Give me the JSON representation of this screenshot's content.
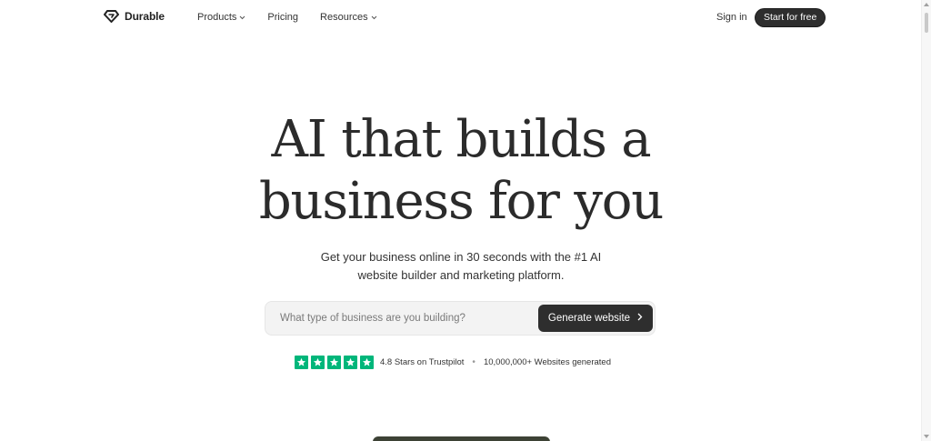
{
  "nav": {
    "brand": "Durable",
    "links": [
      {
        "label": "Products",
        "has_dropdown": true
      },
      {
        "label": "Pricing",
        "has_dropdown": false
      },
      {
        "label": "Resources",
        "has_dropdown": true
      }
    ],
    "signin": "Sign in",
    "cta": "Start for free"
  },
  "hero": {
    "title_line1": "AI that builds a",
    "title_line2": "business for you",
    "subtitle_line1": "Get your business online in 30 seconds with the #1 AI",
    "subtitle_line2": "website builder and marketing platform."
  },
  "search": {
    "placeholder": "What type of business are you building?",
    "value": "",
    "button_label": "Generate website"
  },
  "rating": {
    "stars": 5,
    "star_color": "#00b67a",
    "text": "4.8 Stars on Trustpilot",
    "separator": "•",
    "websites": "10,000,000+ Websites generated"
  },
  "colors": {
    "dark_button": "#2e2e2e",
    "text": "#2b2b2b"
  }
}
